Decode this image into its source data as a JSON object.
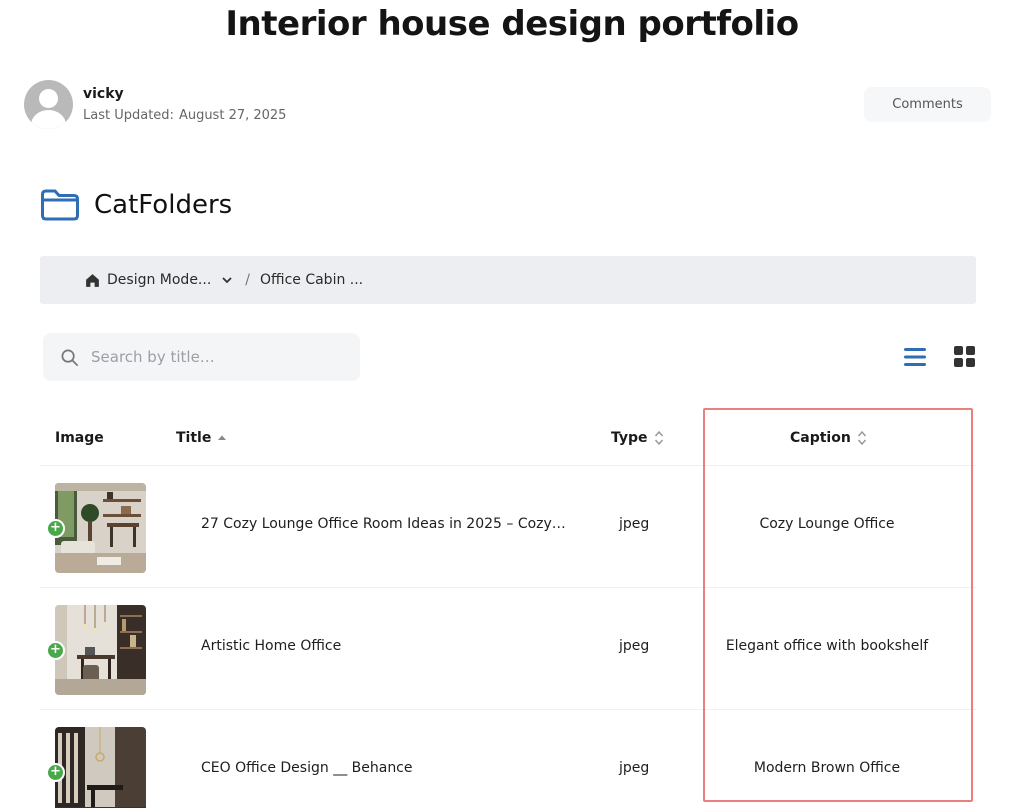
{
  "page": {
    "title": "Interior house design portfolio"
  },
  "author": {
    "name": "vicky",
    "updated_label": "Last Updated:",
    "updated_date": "August 27, 2025"
  },
  "comments_label": "Comments",
  "folders": {
    "title": "CatFolders"
  },
  "breadcrumb": {
    "items": [
      "Design Mode...",
      "Office Cabin ..."
    ],
    "separator": "/"
  },
  "search": {
    "placeholder": "Search by title…"
  },
  "table": {
    "columns": {
      "image": "Image",
      "title": "Title",
      "type": "Type",
      "caption": "Caption"
    },
    "rows": [
      {
        "title": "27 Cozy Lounge Office Room Ideas in 2025 – Cozy…",
        "type": "jpeg",
        "caption": "Cozy Lounge Office"
      },
      {
        "title": "Artistic Home Office",
        "type": "jpeg",
        "caption": "Elegant office with bookshelf"
      },
      {
        "title": "CEO Office Design __ Behance",
        "type": "jpeg",
        "caption": "Modern Brown Office"
      }
    ]
  },
  "colors": {
    "accent": "#2f6eb5",
    "highlight": "#e9807e",
    "badge": "#48a94a"
  }
}
